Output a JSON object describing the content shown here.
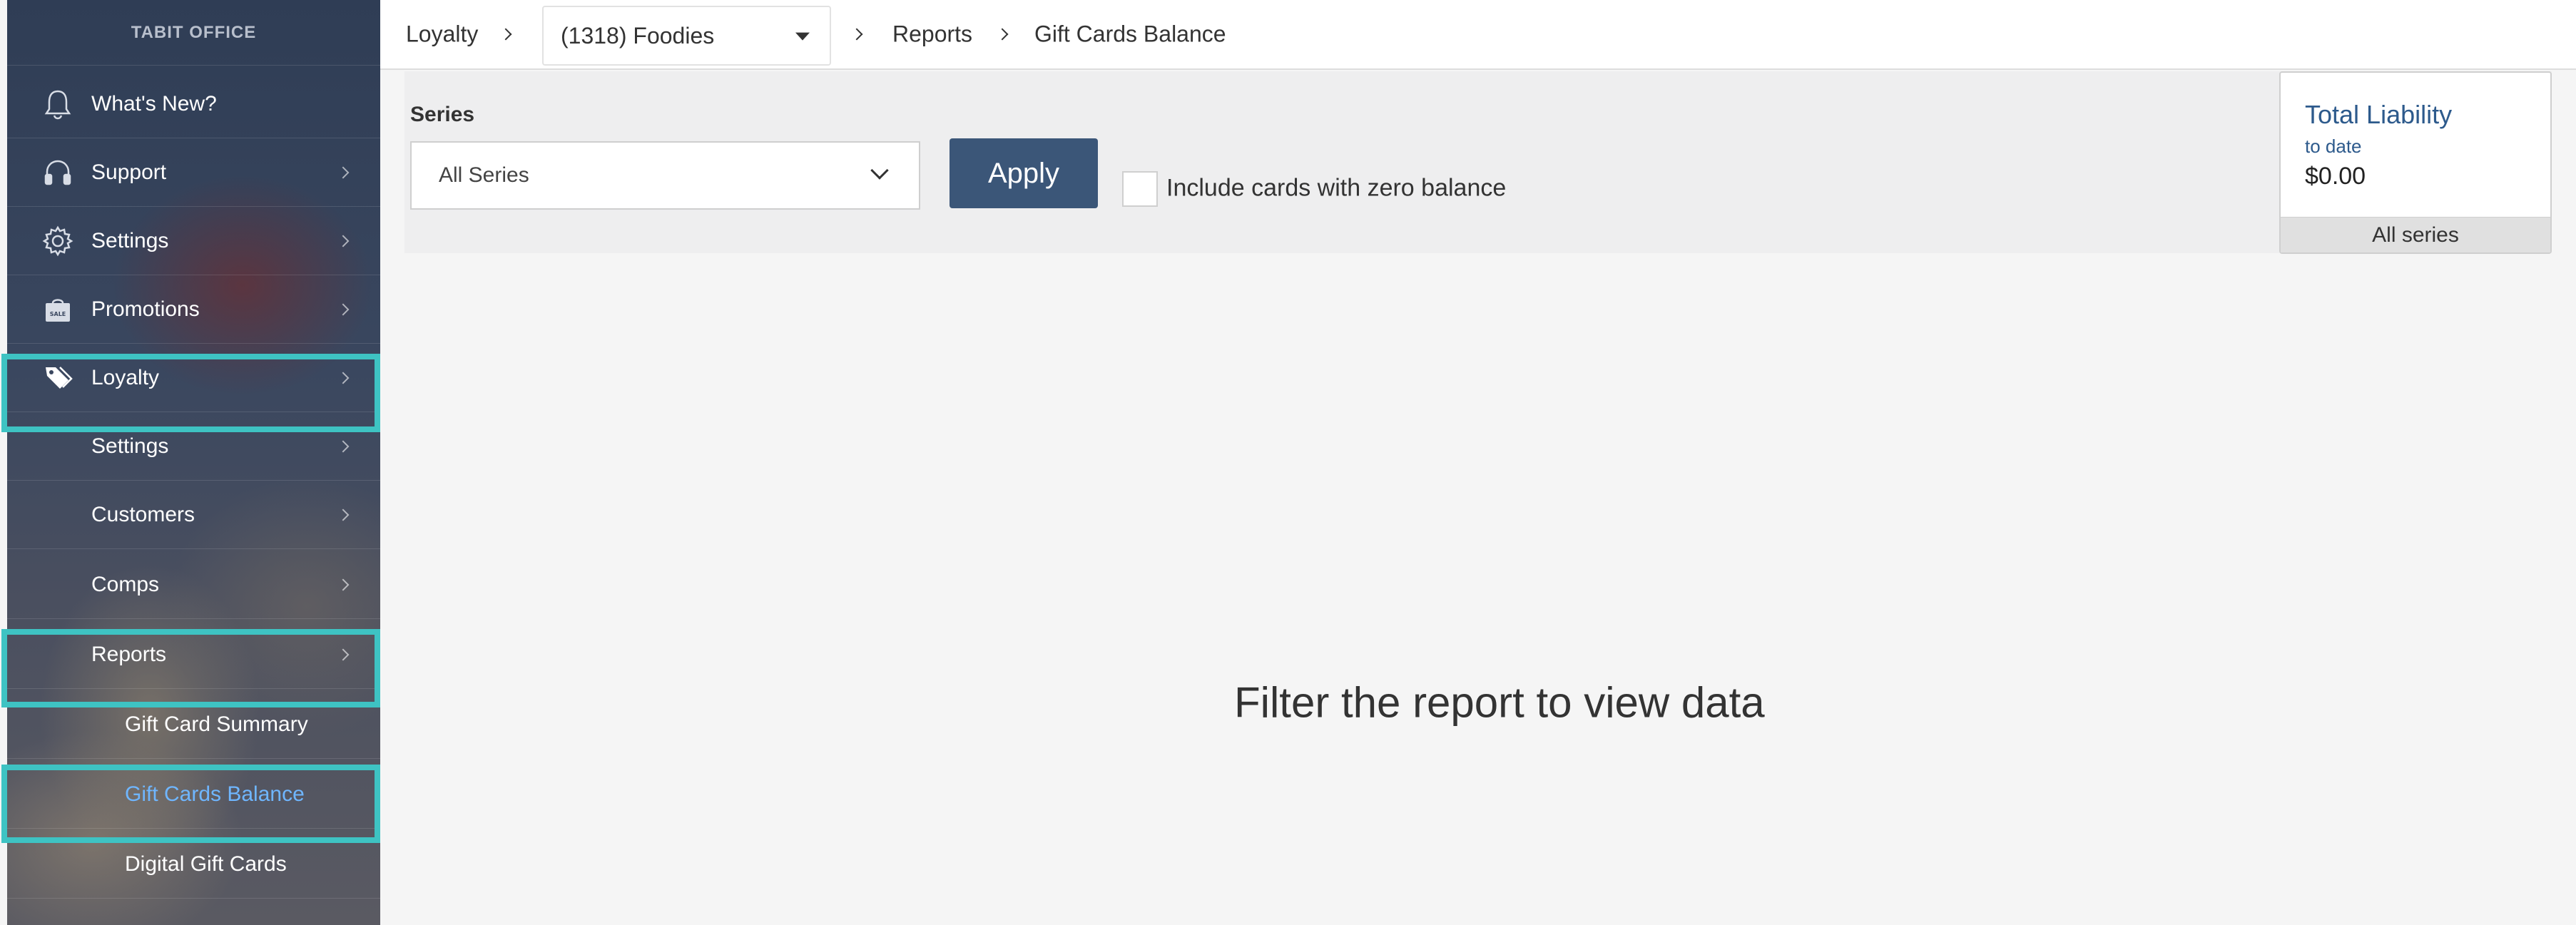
{
  "sidebar": {
    "brand": "TABIT OFFICE",
    "items": [
      {
        "label": "What's New?",
        "icon": "bell-icon"
      },
      {
        "label": "Support",
        "icon": "headset-icon"
      },
      {
        "label": "Settings",
        "icon": "gear-icon"
      },
      {
        "label": "Promotions",
        "icon": "sale-bag-icon"
      },
      {
        "label": "Loyalty",
        "icon": "tag-icon"
      },
      {
        "label": "Settings"
      },
      {
        "label": "Customers"
      },
      {
        "label": "Comps"
      },
      {
        "label": "Reports"
      },
      {
        "label": "Gift Card Summary"
      },
      {
        "label": "Gift Cards Balance"
      },
      {
        "label": "Digital Gift Cards"
      }
    ],
    "highlight_color": "#3ec3c3",
    "active_link_color": "#6fb6ff"
  },
  "topbar": {
    "crumb_loyalty": "Loyalty",
    "org_select_value": "(1318) Foodies",
    "crumb_reports": "Reports",
    "crumb_current": "Gift Cards Balance"
  },
  "filters": {
    "series_label": "Series",
    "series_value": "All Series",
    "apply_label": "Apply",
    "zero_balance_label": "Include cards with zero balance",
    "zero_balance_checked": false,
    "apply_color": "#3b5678"
  },
  "liability": {
    "title": "Total Liability",
    "subtitle": "to date",
    "amount": "$0.00",
    "footer": "All series",
    "title_color": "#2d5a8c"
  },
  "main": {
    "empty_message": "Filter the report to view data"
  }
}
